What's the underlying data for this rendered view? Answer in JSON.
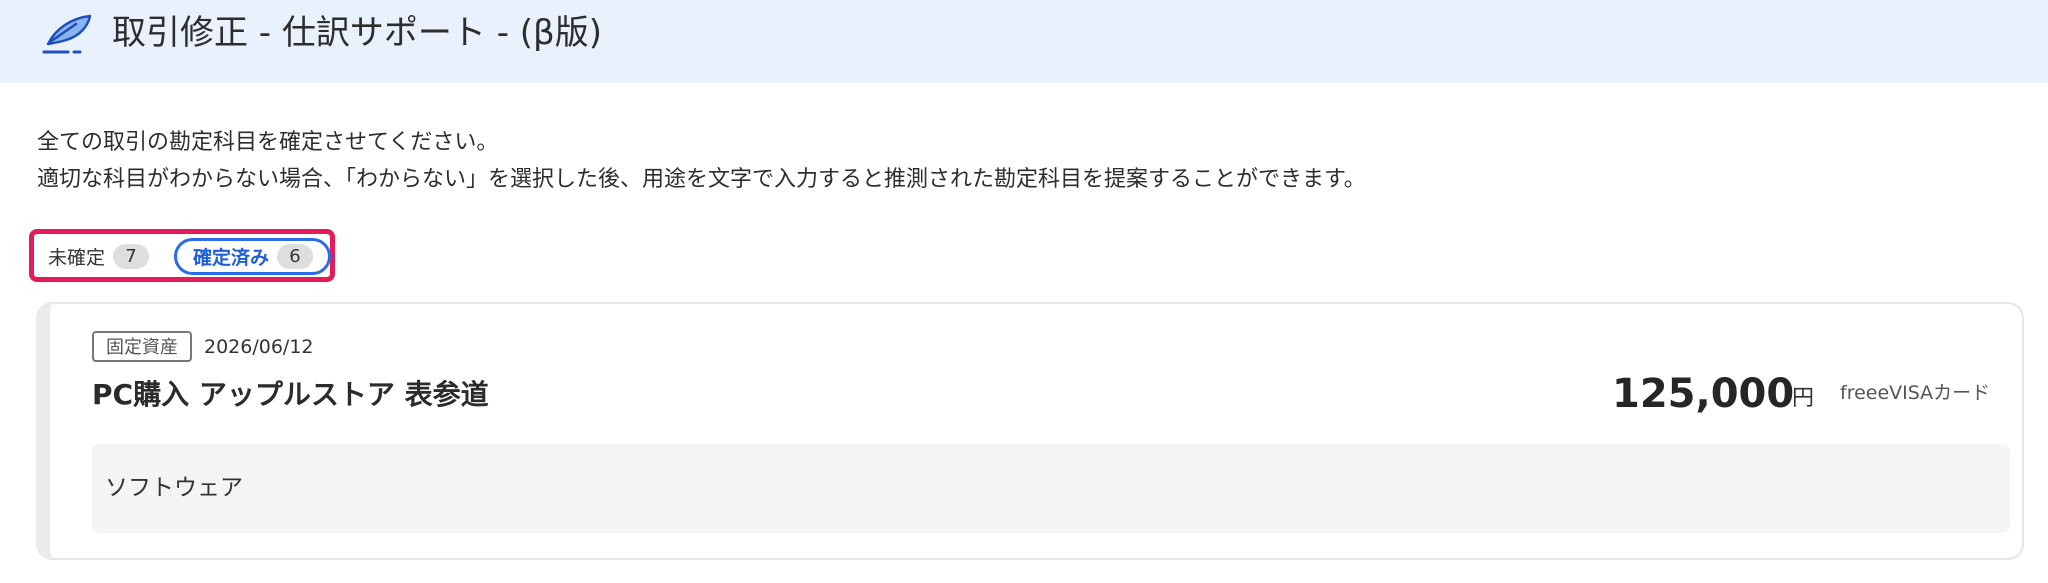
{
  "header": {
    "title": "取引修正 - 仕訳サポート - (β版)",
    "icon": "quill-pen-icon",
    "background": "#e9f1fd"
  },
  "intro": {
    "line1": "全ての取引の勘定科目を確定させてください。",
    "line2": "適切な科目がわからない場合、「わからない」を選択した後、用途を文字で入力すると推測された勘定科目を提案することができます。"
  },
  "tabs": [
    {
      "label": "未確定",
      "count": "7",
      "selected": false
    },
    {
      "label": "確定済み",
      "count": "6",
      "selected": true
    }
  ],
  "highlight_color": "#e41c5c",
  "accent_color": "#2a6be8",
  "transaction": {
    "tag": "固定資産",
    "date": "2026/06/12",
    "title": "PC購入 アップルストア 表参道",
    "amount": "125,000",
    "currency": "円",
    "source": "freeeVISAカード",
    "account": "ソフトウェア"
  }
}
